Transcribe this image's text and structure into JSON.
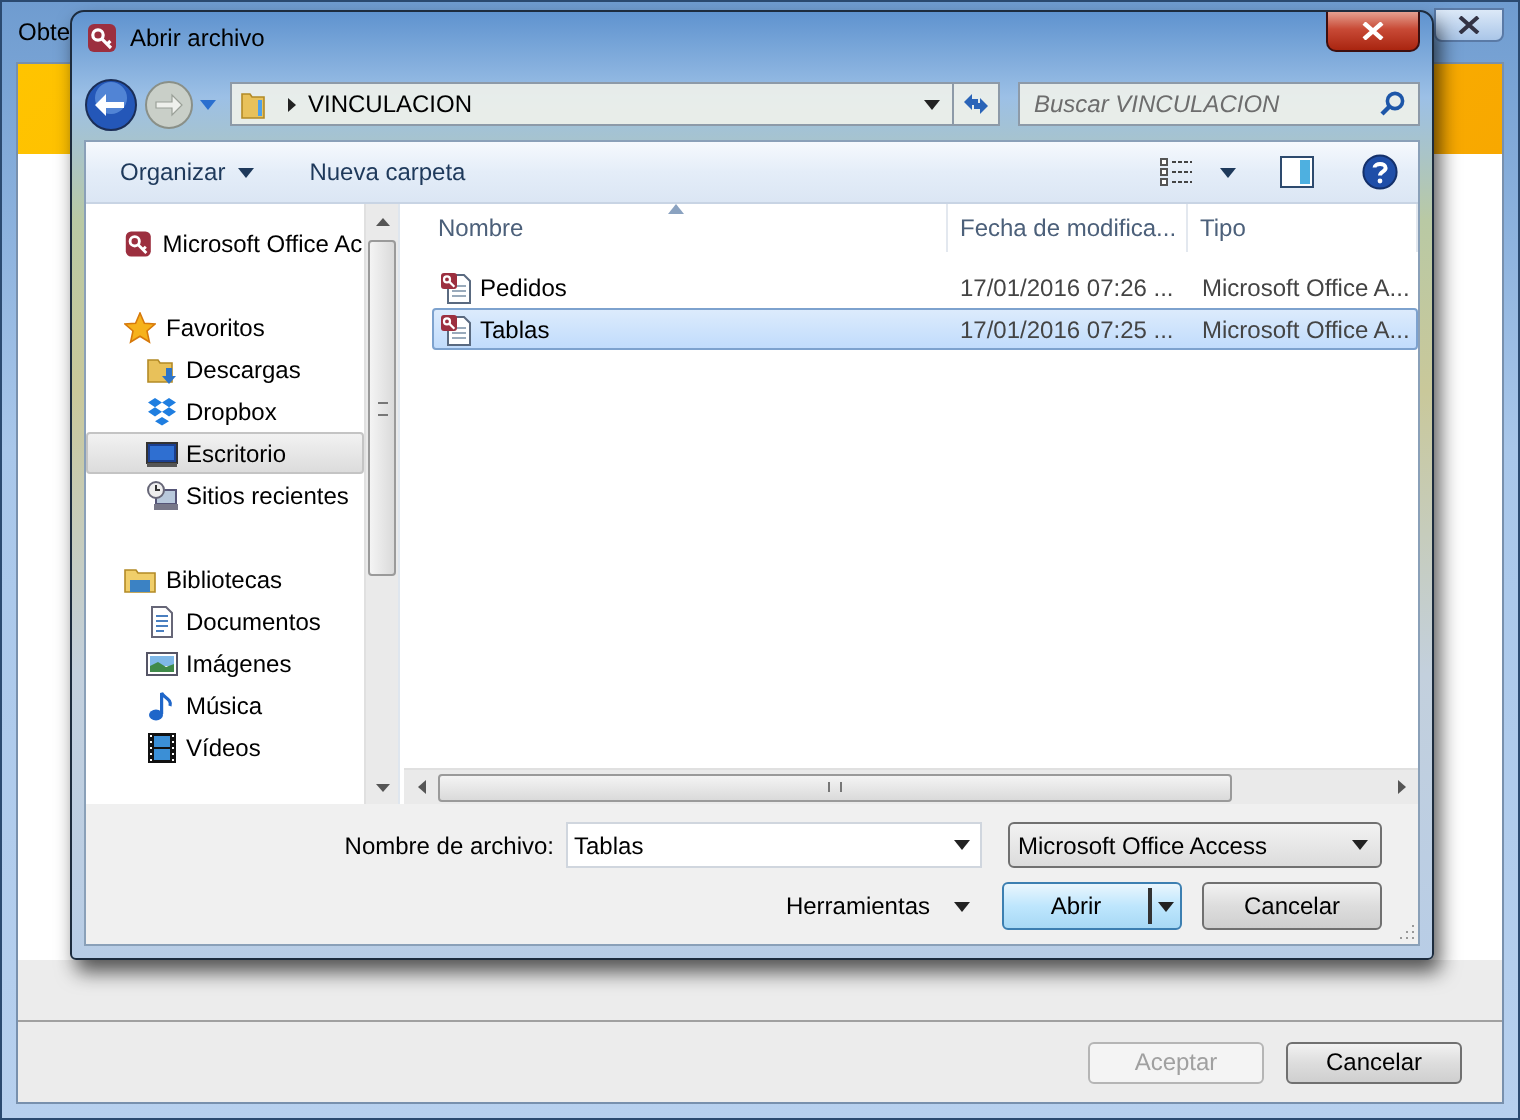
{
  "background_window": {
    "title": "Obte",
    "buttons": [
      {
        "label": "Aceptar",
        "disabled": true
      },
      {
        "label": "Cancelar",
        "disabled": false
      }
    ]
  },
  "dialog": {
    "title": "Abrir archivo",
    "path": "VINCULACION",
    "search": {
      "placeholder": "Buscar VINCULACION"
    },
    "toolbar": [
      {
        "label": "Organizar",
        "kind": "menu"
      },
      {
        "label": "Nueva carpeta",
        "kind": "button"
      }
    ],
    "nav": [
      {
        "label": "Microsoft Office Ac",
        "kind": "access",
        "selected": false
      },
      {
        "label": "Favoritos",
        "kind": "star",
        "selected": false,
        "children": [
          {
            "label": "Descargas",
            "kind": "downloads",
            "selected": false
          },
          {
            "label": "Dropbox",
            "kind": "dropbox",
            "selected": false
          },
          {
            "label": "Escritorio",
            "kind": "desktop",
            "selected": true
          },
          {
            "label": "Sitios recientes",
            "kind": "recent",
            "selected": false
          }
        ]
      },
      {
        "label": "Bibliotecas",
        "kind": "library",
        "selected": false,
        "children": [
          {
            "label": "Documentos",
            "kind": "documents",
            "selected": false
          },
          {
            "label": "Imágenes",
            "kind": "images",
            "selected": false
          },
          {
            "label": "Música",
            "kind": "music",
            "selected": false
          },
          {
            "label": "Vídeos",
            "kind": "videos",
            "selected": false
          }
        ]
      }
    ],
    "columns": [
      {
        "label": "Nombre",
        "sorted": true
      },
      {
        "label": "Fecha de modifica...",
        "sorted": false
      },
      {
        "label": "Tipo",
        "sorted": false
      }
    ],
    "files": [
      {
        "name": "Pedidos",
        "date": "17/01/2016 07:26 ...",
        "type": "Microsoft Office A...",
        "selected": false
      },
      {
        "name": "Tablas",
        "date": "17/01/2016 07:25 ...",
        "type": "Microsoft Office A...",
        "selected": true
      }
    ],
    "filename": {
      "label": "Nombre de archivo:",
      "value": "Tablas"
    },
    "filter": "Microsoft Office Access",
    "tools": "Herramientas",
    "open_button": "Abrir",
    "cancel_button": "Cancelar"
  }
}
